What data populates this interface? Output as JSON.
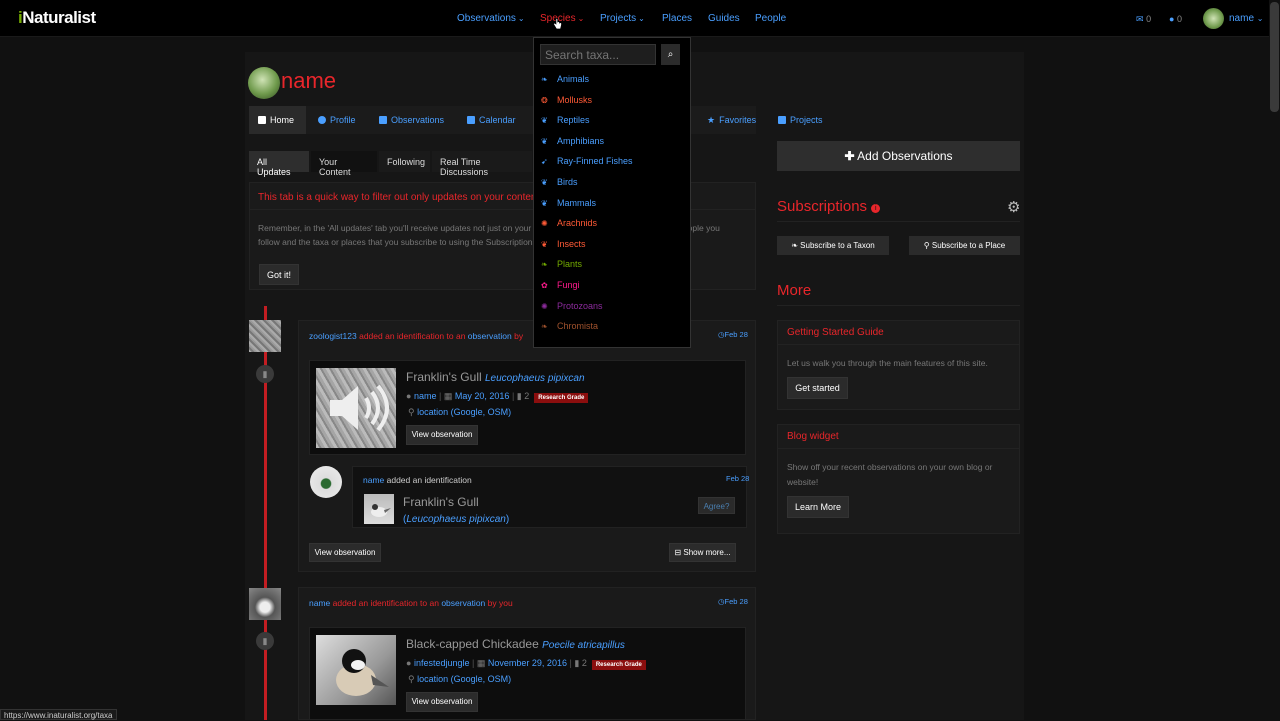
{
  "app": {
    "logo_i": "i",
    "logo_rest": "Naturalist"
  },
  "nav": {
    "items": [
      "Observations",
      "Species",
      "Projects",
      "Places",
      "Guides",
      "People"
    ],
    "carets": [
      "⌄",
      "⌄",
      "⌄"
    ],
    "mail_count": "0",
    "chat_count": "0",
    "user": "name"
  },
  "profile": {
    "name": "name"
  },
  "tabs": [
    "Home",
    "Profile",
    "Observations",
    "Calendar",
    "Favorites",
    "Projects"
  ],
  "subtabs": [
    "All Updates",
    "Your Content",
    "Following",
    "Real Time Discussions"
  ],
  "info": {
    "title": "This tab is a quick way to filter out only updates on your content.",
    "text_line1": "Remember, in the 'All updates' tab you'll receive updates not just on your content, but also on the content of the people you",
    "text_line2": "follow and the taxa or places that you subscribe to using the Subscriptions settings.",
    "got_it": "Got it!"
  },
  "feed": [
    {
      "user": "zoologist123",
      "action": " added an identification to an ",
      "link": "observation",
      "by": " by",
      "date": "Feb 28",
      "common": "Franklin's Gull",
      "sci": "Leucophaeus pipixcan",
      "observer": "name",
      "obs_date": "May 20, 2016",
      "ids": "2",
      "grade": "Research Grade",
      "location": "location",
      "loc_links": "(Google, OSM)",
      "view": "View observation",
      "sub": {
        "user": "name",
        "action": " added an identification",
        "date": "Feb 28",
        "common": "Franklin's Gull",
        "sci": "Leucophaeus pipixcan",
        "agree": "Agree?"
      },
      "view2": "View observation",
      "show_more": "Show more..."
    },
    {
      "user": "name",
      "action": " added an identification to an ",
      "link": "observation",
      "by": " by you",
      "date": "Feb 28",
      "common": "Black-capped Chickadee",
      "sci": "Poecile atricapillus",
      "observer": "infestedjungle",
      "obs_date": "November 29, 2016",
      "ids": "2",
      "grade": "Research Grade",
      "location": "location",
      "loc_links": "(Google, OSM)",
      "view": "View observation"
    }
  ],
  "sidebar": {
    "add_obs": "Add Observations",
    "subscriptions": "Subscriptions",
    "sub_taxon": "Subscribe to a Taxon",
    "sub_place": "Subscribe to a Place",
    "more": "More",
    "guide_title": "Getting Started Guide",
    "guide_text": "Let us walk you through the main features of this site.",
    "guide_btn": "Get started",
    "blog_title": "Blog widget",
    "blog_text1": "Show off your recent observations on your own blog or",
    "blog_text2": "website!",
    "blog_btn": "Learn More"
  },
  "dropdown": {
    "placeholder": "Search taxa...",
    "taxa": [
      {
        "label": "Animals",
        "color": "#4a9fff"
      },
      {
        "label": "Mollusks",
        "color": "#ff5a36"
      },
      {
        "label": "Reptiles",
        "color": "#4a9fff"
      },
      {
        "label": "Amphibians",
        "color": "#4a9fff"
      },
      {
        "label": "Ray-Finned Fishes",
        "color": "#4a9fff"
      },
      {
        "label": "Birds",
        "color": "#4a9fff"
      },
      {
        "label": "Mammals",
        "color": "#4a9fff"
      },
      {
        "label": "Arachnids",
        "color": "#ff5a36"
      },
      {
        "label": "Insects",
        "color": "#ff5a36"
      },
      {
        "label": "Plants",
        "color": "#74ac00"
      },
      {
        "label": "Fungi",
        "color": "#ff1a8c"
      },
      {
        "label": "Protozoans",
        "color": "#8b2a9b"
      },
      {
        "label": "Chromista",
        "color": "#a0522d"
      }
    ]
  },
  "status_url": "https://www.inaturalist.org/taxa"
}
